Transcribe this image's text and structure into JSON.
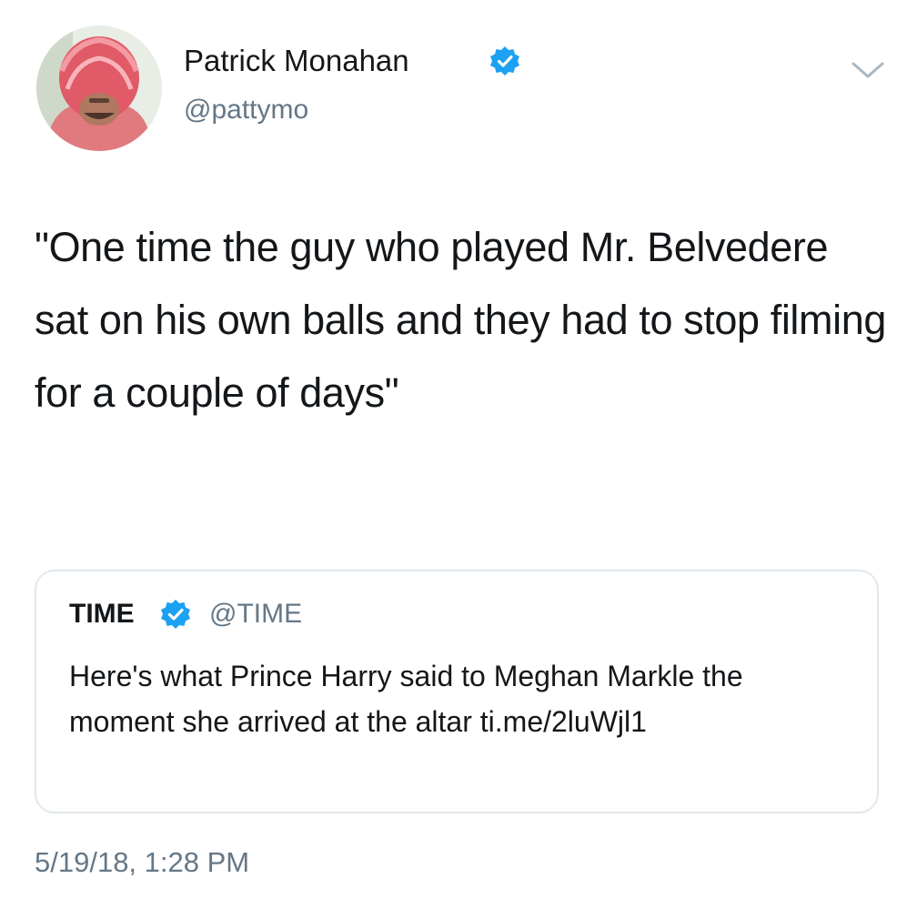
{
  "author": {
    "name": "Patrick Monahan",
    "handle": "@pattymo",
    "verified": true,
    "avatar_icon": "avatar-photo-pink-hood"
  },
  "menu": {
    "icon": "chevron-down-icon"
  },
  "tweet": {
    "text": "\"One time the guy who played Mr. Belvedere sat on his own balls and they had to stop filming for a couple of days\""
  },
  "quoted_tweet": {
    "name": "TIME",
    "handle": "@TIME",
    "verified": true,
    "text": "Here's what Prince Harry said to Meghan Markle the moment she arrived at the altar ti.me/2luWjl1"
  },
  "timestamp": "5/19/18, 1:28 PM",
  "colors": {
    "verified_blue": "#1da1f2",
    "text_primary": "#14171a",
    "text_secondary": "#657786",
    "card_border": "#e1e8ed"
  }
}
